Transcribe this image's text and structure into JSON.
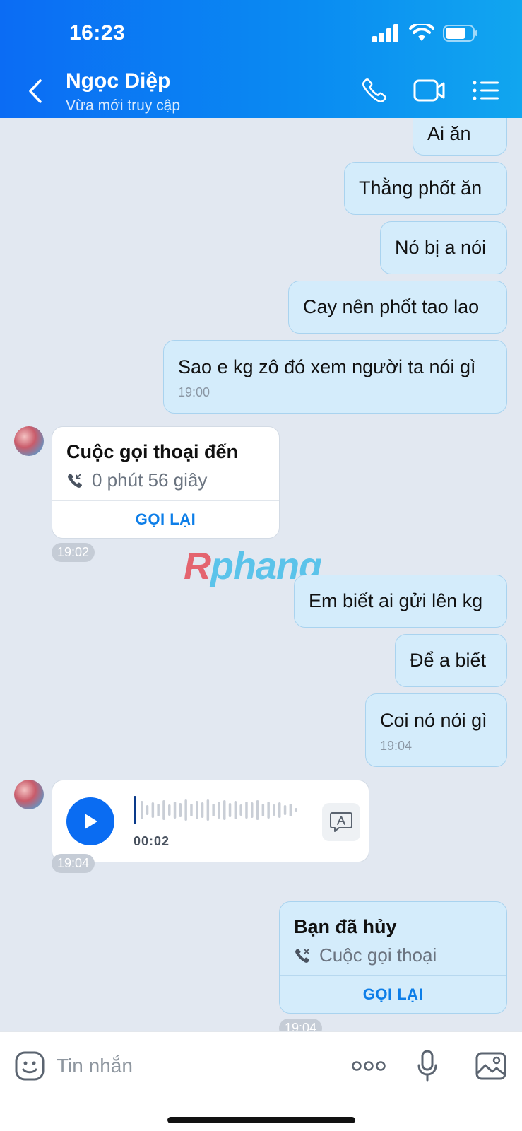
{
  "status_bar": {
    "time": "16:23"
  },
  "header": {
    "contact_name": "Ngọc Diệp",
    "contact_status": "Vừa mới truy cập"
  },
  "messages": [
    {
      "text": "Ai ăn"
    },
    {
      "text": "Thằng phốt ăn"
    },
    {
      "text": "Nó bị a nói"
    },
    {
      "text": "Cay nên phốt tao lao"
    },
    {
      "text": "Sao e kg zô đó xem người ta nói gì",
      "time": "19:00"
    },
    {
      "text": "Em biết ai gửi lên kg"
    },
    {
      "text": "Để a biết"
    },
    {
      "text": "Coi nó nói gì",
      "time": "19:04"
    }
  ],
  "incoming_call": {
    "title": "Cuộc gọi thoại đến",
    "duration": "0 phút 56 giây",
    "action": "GỌI LẠI",
    "time": "19:02"
  },
  "watermark": {
    "part1": "R",
    "part2": "phang"
  },
  "voice_message": {
    "duration": "00:02",
    "progress": 0.0,
    "time": "19:04"
  },
  "cancelled_call": {
    "title": "Bạn đã hủy",
    "subtitle": "Cuộc gọi thoại",
    "action": "GỌI LẠI",
    "time": "19:04"
  },
  "input_bar": {
    "placeholder": "Tin nhắn"
  },
  "colors": {
    "accent": "#0a6cf2",
    "sent_bubble": "#d4ecfb",
    "chat_bg": "#e2e8f1"
  }
}
